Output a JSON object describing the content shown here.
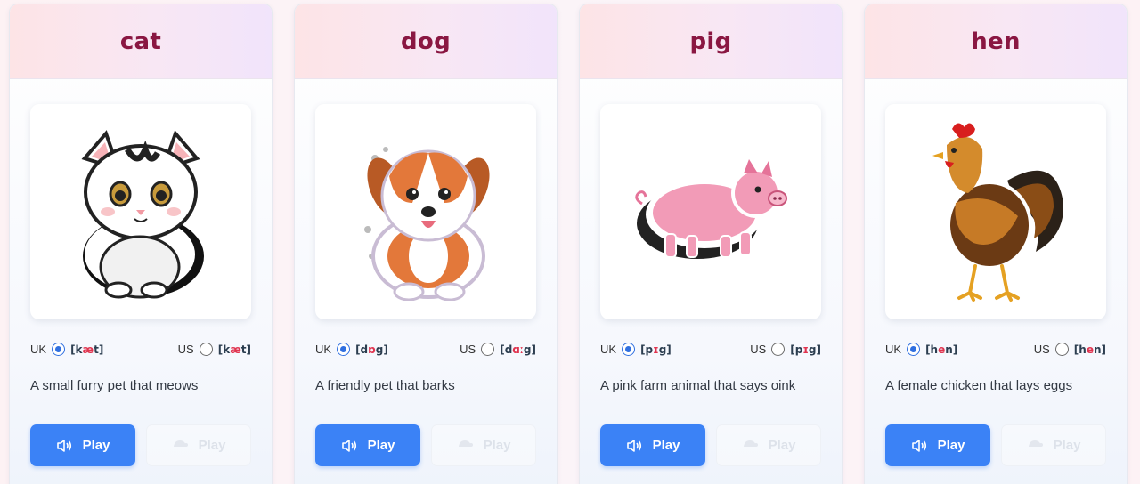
{
  "cards": [
    {
      "word": "cat",
      "uk_label": "UK",
      "uk_ipa": [
        "[k",
        "æ",
        "t]"
      ],
      "us_label": "US",
      "us_ipa": [
        "[k",
        "æ",
        "t]"
      ],
      "description": "A small furry pet that meows",
      "play_label": "Play",
      "play2_label": "Play",
      "image_icon": "cat-sticker-icon"
    },
    {
      "word": "dog",
      "uk_label": "UK",
      "uk_ipa": [
        "[d",
        "ɒ",
        "g]"
      ],
      "us_label": "US",
      "us_ipa": [
        "[d",
        "ɑː",
        "g]"
      ],
      "description": "A friendly pet that barks",
      "play_label": "Play",
      "play2_label": "Play",
      "image_icon": "dog-sticker-icon"
    },
    {
      "word": "pig",
      "uk_label": "UK",
      "uk_ipa": [
        "[p",
        "ɪ",
        "g]"
      ],
      "us_label": "US",
      "us_ipa": [
        "[p",
        "ɪ",
        "g]"
      ],
      "description": "A pink farm animal that says oink",
      "play_label": "Play",
      "play2_label": "Play",
      "image_icon": "pig-sticker-icon"
    },
    {
      "word": "hen",
      "uk_label": "UK",
      "uk_ipa": [
        "[h",
        "e",
        "n]"
      ],
      "us_label": "US",
      "us_ipa": [
        "[h",
        "e",
        "n]"
      ],
      "description": "A female chicken that lays eggs",
      "play_label": "Play",
      "play2_label": "Play",
      "image_icon": "hen-sticker-icon"
    }
  ],
  "selected_accent": "UK",
  "colors": {
    "word": "#8a1742",
    "play_button": "#3b82f6",
    "ipa_highlight": "#e0344f",
    "radio_selected": "#2f6fe0"
  }
}
